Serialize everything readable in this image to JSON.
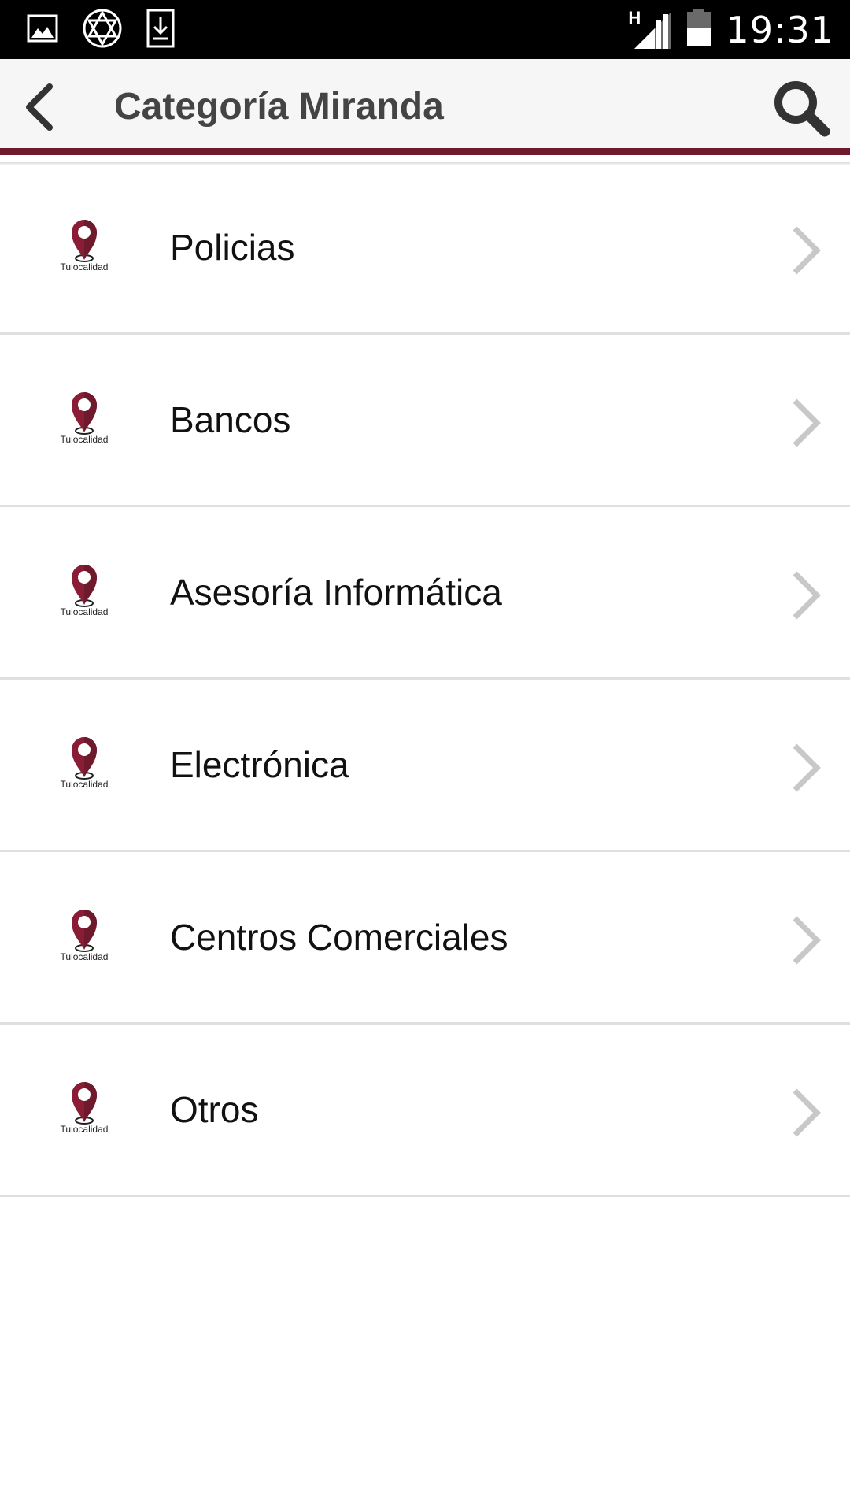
{
  "status_bar": {
    "time": "19:31",
    "network": "H",
    "icons": [
      "gallery-icon",
      "star-of-david-icon",
      "download-icon",
      "signal-icon",
      "battery-icon"
    ]
  },
  "app_bar": {
    "title": "Categoría Miranda",
    "back_icon": "chevron-left-icon",
    "search_icon": "search-icon",
    "accent_color": "#6e1a2c"
  },
  "list": {
    "logo_text": "Tulocalidad",
    "items": [
      {
        "label": "Policias"
      },
      {
        "label": "Bancos"
      },
      {
        "label": "Asesoría Informática"
      },
      {
        "label": "Electrónica"
      },
      {
        "label": "Centros Comerciales"
      },
      {
        "label": "Otros"
      }
    ]
  }
}
